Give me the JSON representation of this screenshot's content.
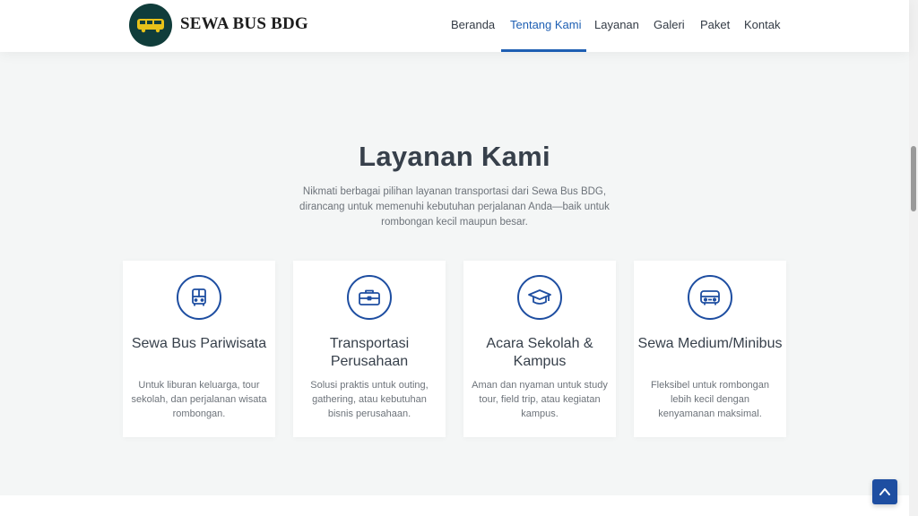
{
  "brand": {
    "name": "SEWA BUS BDG"
  },
  "nav": {
    "items": [
      {
        "label": "Beranda"
      },
      {
        "label": "Tentang Kami"
      },
      {
        "label": "Layanan"
      },
      {
        "label": "Galeri"
      },
      {
        "label": "Paket"
      },
      {
        "label": "Kontak"
      }
    ],
    "active": "Tentang Kami"
  },
  "services": {
    "title": "Layanan Kami",
    "description": "Nikmati berbagai pilihan layanan transportasi dari Sewa Bus BDG, dirancang untuk memenuhi kebutuhan perjalanan Anda—baik untuk rombongan kecil maupun besar.",
    "cards": [
      {
        "icon": "bus-icon",
        "title": "Sewa Bus Pariwisata",
        "text": "Untuk liburan keluarga, tour sekolah, dan perjalanan wisata rombongan."
      },
      {
        "icon": "briefcase-icon",
        "title": "Transportasi Perusahaan",
        "text": "Solusi praktis untuk outing, gathering, atau kebutuhan bisnis perusahaan."
      },
      {
        "icon": "graduation-cap-icon",
        "title": "Acara Sekolah & Kampus",
        "text": "Aman dan nyaman untuk study tour, field trip, atau kegiatan kampus."
      },
      {
        "icon": "minibus-icon",
        "title": "Sewa Medium/Minibus",
        "text": "Fleksibel untuk rombongan lebih kecil dengan kenyamanan maksimal."
      }
    ]
  },
  "colors": {
    "accent": "#1e4ea1",
    "nav_active": "#1e5fb3",
    "logo_bg": "#103d3b",
    "section_bg": "#f4f6f6"
  }
}
